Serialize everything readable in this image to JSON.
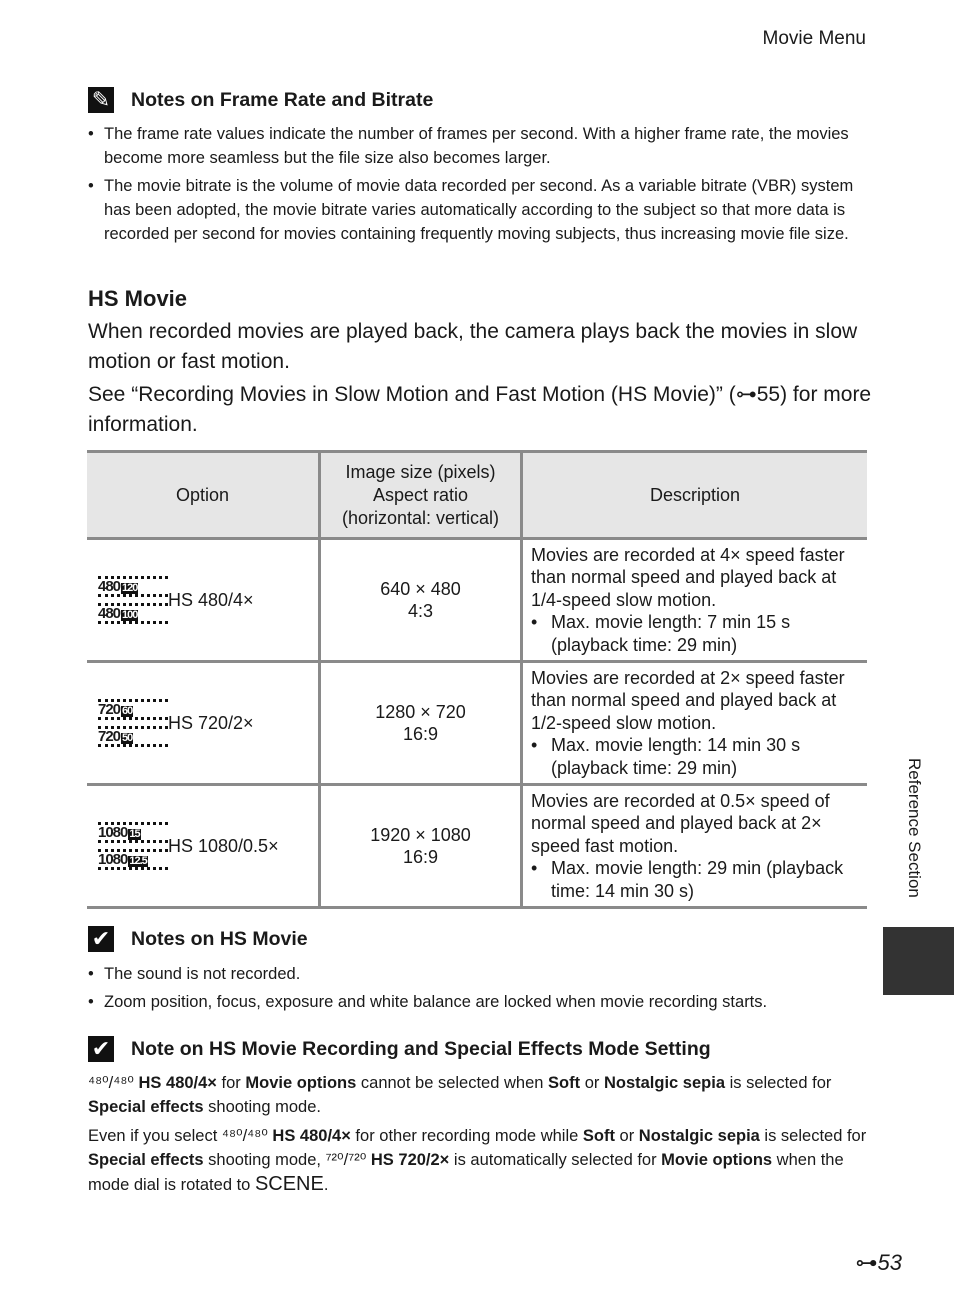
{
  "running_head": "Movie Menu",
  "note1": {
    "icon": "pencil-note-icon",
    "title": "Notes on Frame Rate and Bitrate",
    "bullets": [
      "The frame rate values indicate the number of frames per second. With a higher frame rate, the movies become more seamless but the file size also becomes larger.",
      "The movie bitrate is the volume of movie data recorded per second. As a variable bitrate (VBR) system has been adopted, the movie bitrate varies automatically according to the subject so that more data is recorded per second for movies containing frequently moving subjects, thus increasing movie file size."
    ]
  },
  "section": {
    "title": "HS Movie",
    "para1": "When recorded movies are played back, the camera plays back the movies in slow motion or fast motion.",
    "para2": "See “Recording Movies in Slow Motion and Fast Motion (HS Movie)” (⊶55) for more information."
  },
  "table": {
    "headers": [
      "Option",
      "Image size (pixels)\nAspect ratio\n(horizontal: vertical)",
      "Description"
    ],
    "header_lines": [
      "Image size (pixels)",
      "Aspect ratio",
      "(horizontal: vertical)"
    ],
    "rows": [
      {
        "icons": [
          {
            "res": "480",
            "fr": "120"
          },
          {
            "res": "480",
            "fr": "100"
          }
        ],
        "option": "HS 480/4×",
        "size": "640 × 480",
        "aspect": "4:3",
        "desc": "Movies are recorded at 4× speed faster than normal speed and played back at 1/4-speed slow motion.",
        "bullet": "Max. movie length: 7 min 15 s (playback time: 29 min)"
      },
      {
        "icons": [
          {
            "res": "720",
            "fr": "60"
          },
          {
            "res": "720",
            "fr": "50"
          }
        ],
        "option": "HS 720/2×",
        "size": "1280 × 720",
        "aspect": "16:9",
        "desc": "Movies are recorded at 2× speed faster than normal speed and played back at 1/2-speed slow motion.",
        "bullet": "Max. movie length: 14 min 30 s (playback time: 29 min)"
      },
      {
        "icons": [
          {
            "res": "1080",
            "fr": "15"
          },
          {
            "res": "1080",
            "fr": "12.5"
          }
        ],
        "option": "HS 1080/0.5×",
        "size": "1920 × 1080",
        "aspect": "16:9",
        "desc": "Movies are recorded at 0.5× speed of normal speed and played back at 2× speed fast motion.",
        "bullet": "Max. movie length: 29 min (playback time: 14 min 30 s)"
      }
    ]
  },
  "note2": {
    "icon": "check-icon",
    "title": "Notes on HS Movie",
    "bullets": [
      "The sound is not recorded.",
      "Zoom position, focus, exposure and white balance are locked when movie recording starts."
    ]
  },
  "note3": {
    "icon": "check-icon",
    "title": "Note on HS Movie Recording and Special Effects Mode Setting",
    "p1": {
      "opt": "HS 480/4×",
      "t1": " for ",
      "k1": "Movie options",
      "t2": " cannot be selected when ",
      "k2": "Soft",
      "t3": " or ",
      "k3": "Nostalgic sepia",
      "t4": " is selected for ",
      "k4": "Special effects",
      "t5": " shooting mode."
    },
    "p2": {
      "t0": "Even if you select ",
      "opt": "HS 480/4×",
      "t1": " for other recording mode while ",
      "k1": "Soft",
      "t2": " or ",
      "k2": "Nostalgic sepia",
      "t3": " is selected for ",
      "k3": "Special effects",
      "t4": " shooting mode, ",
      "opt2": "HS 720/2×",
      "t5": " is automatically selected for ",
      "k4": "Movie options",
      "t6": " when the mode dial is rotated to ",
      "scene": "SCENE",
      "t7": "."
    }
  },
  "side_label": "Reference Section",
  "folio": "⊶53"
}
